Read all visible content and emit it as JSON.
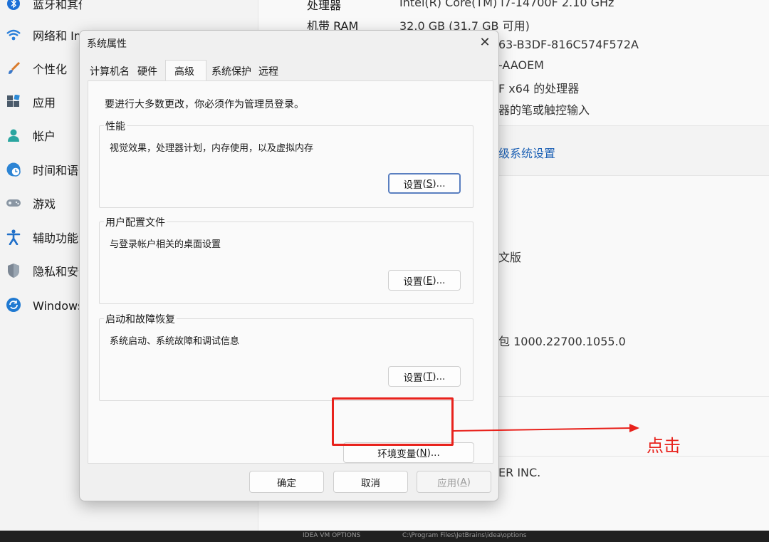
{
  "sidebar": {
    "items": [
      {
        "label": "蓝牙和其他设备",
        "icon": "bluetooth-icon"
      },
      {
        "label": "网络和 Internet",
        "icon": "wifi-icon"
      },
      {
        "label": "个性化",
        "icon": "brush-icon"
      },
      {
        "label": "应用",
        "icon": "apps-icon"
      },
      {
        "label": "帐户",
        "icon": "person-icon"
      },
      {
        "label": "时间和语言",
        "icon": "clock-globe-icon"
      },
      {
        "label": "游戏",
        "icon": "gamepad-icon"
      },
      {
        "label": "辅助功能",
        "icon": "accessibility-icon"
      },
      {
        "label": "隐私和安全性",
        "icon": "shield-icon"
      },
      {
        "label": "Windows 更新",
        "icon": "update-icon"
      }
    ]
  },
  "main": {
    "specs": [
      {
        "label": "处理器",
        "value": "Intel(R) Core(TM) i7-14700F   2.10 GHz"
      },
      {
        "label": "机带 RAM",
        "value": "32.0 GB (31.7 GB 可用)"
      }
    ],
    "device_id_tail": "63-B3DF-816C574F572A",
    "product_id_tail": "-AAOEM",
    "system_type_tail": "F x64 的处理器",
    "pen_touch_tail": "器的笔或触控输入",
    "advanced_link_tail": "级系统设置",
    "edition_tail": "文版",
    "experience_tail": "包 1000.22700.1055.0",
    "company_tail": "ER INC."
  },
  "taskbar": {
    "items": [
      "IDEA VM OPTIONS",
      "C:\\Program Files\\JetBrains\\idea\\options"
    ]
  },
  "dialog": {
    "title": "系统属性",
    "close_glyph": "✕",
    "tabs": [
      "计算机名",
      "硬件",
      "高级",
      "系统保护",
      "远程"
    ],
    "admin_note": "要进行大多数更改，你必须作为管理员登录。",
    "groups": [
      {
        "title": "性能",
        "desc": "视觉效果，处理器计划，内存使用，以及虚拟内存",
        "button_text": "设置",
        "button_key": "S"
      },
      {
        "title": "用户配置文件",
        "desc": "与登录帐户相关的桌面设置",
        "button_text": "设置",
        "button_key": "E"
      },
      {
        "title": "启动和故障恢复",
        "desc": "系统启动、系统故障和调试信息",
        "button_text": "设置",
        "button_key": "T"
      }
    ],
    "env_button": {
      "text": "环境变量",
      "key": "N"
    },
    "footer": {
      "ok": "确定",
      "cancel": "取消",
      "apply_text": "应用",
      "apply_key": "A"
    }
  },
  "annotation": {
    "label": "点击",
    "color": "#e8221c"
  },
  "colors": {
    "accent_link": "#1a5fb4",
    "annotation_red": "#e8221c",
    "focus_border": "#5a7fc0"
  }
}
